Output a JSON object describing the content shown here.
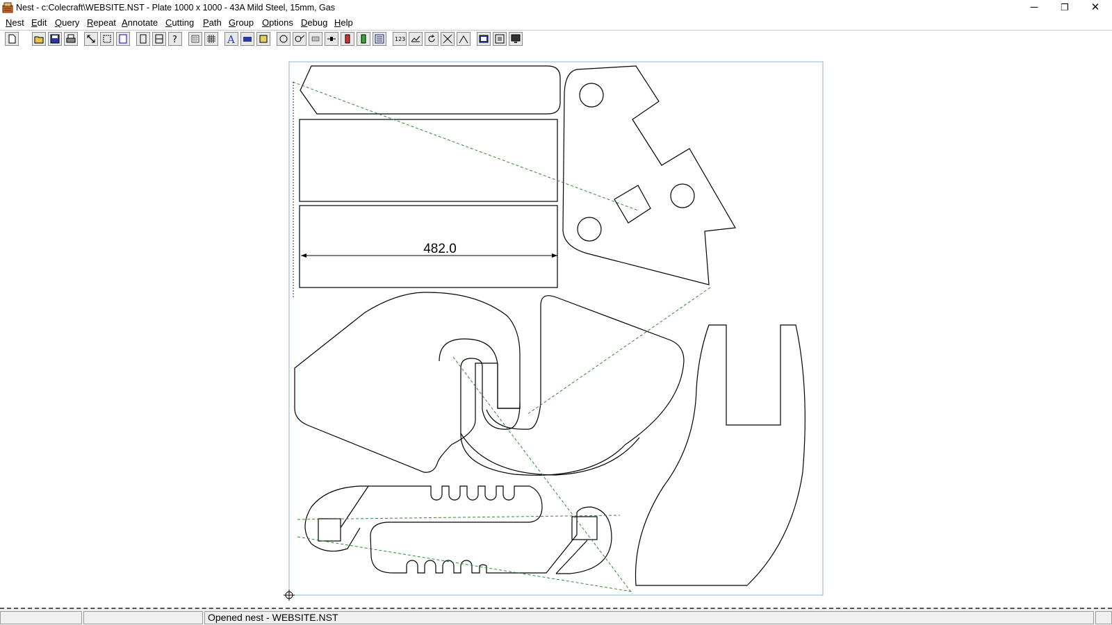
{
  "window": {
    "title": "Nest - c:Colecraft\\WEBSITE.NST  - Plate 1000 x 1000 - 43A Mild Steel, 15mm, Gas",
    "minimize_glyph": "─",
    "restore_glyph": "❐",
    "close_glyph": "✕"
  },
  "menu": {
    "items": [
      {
        "key": "N",
        "rest": "est"
      },
      {
        "key": "E",
        "rest": "dit"
      },
      {
        "key": "Q",
        "rest": "uery"
      },
      {
        "key": "R",
        "rest": "epeat"
      },
      {
        "key": "A",
        "rest": "nnotate"
      },
      {
        "key": "C",
        "rest": "utting"
      },
      {
        "key": "P",
        "rest": "ath"
      },
      {
        "key": "G",
        "rest": "roup"
      },
      {
        "key": "O",
        "rest": "ptions"
      },
      {
        "key": "D",
        "rest": "ebug"
      },
      {
        "key": "H",
        "rest": "elp"
      }
    ]
  },
  "toolbar": {
    "icons": [
      "new-icon",
      "open-folder-icon",
      "save-icon",
      "print-icon",
      "zoom-fit-icon",
      "zoom-window-icon",
      "zoom-page-icon",
      "part-icon",
      "layout-icon",
      "help-icon",
      "grid-small-icon",
      "grid-icon",
      "text-icon",
      "label-icon",
      "marker-icon",
      "cut-tool-icon",
      "pierce-icon",
      "lead-icon",
      "link-icon",
      "start-point-icon",
      "end-point-icon",
      "sheet-icon",
      "numbering-icon",
      "measure-icon",
      "rotate-icon",
      "cross-icon",
      "line-icon",
      "view1-icon",
      "view2-icon",
      "monitor-icon"
    ]
  },
  "canvas": {
    "dimension_label": "482.0",
    "colors": {
      "part_outline": "#000000",
      "plate_border": "#7fb9cf",
      "cut_path": "#2c8a2c"
    }
  },
  "status": {
    "message": "Opened nest - WEBSITE.NST"
  }
}
